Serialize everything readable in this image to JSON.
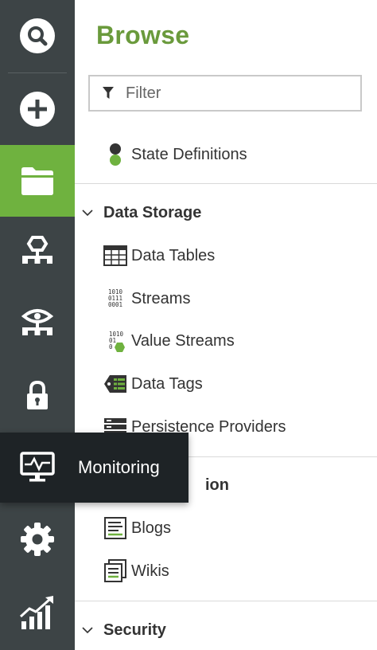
{
  "sidebar": {
    "items": [
      {
        "name": "search"
      },
      {
        "name": "new"
      },
      {
        "name": "browse",
        "active": true
      },
      {
        "name": "modeling"
      },
      {
        "name": "visibility"
      },
      {
        "name": "security"
      },
      {
        "name": "monitoring"
      },
      {
        "name": "settings"
      },
      {
        "name": "analytics"
      }
    ],
    "active_color": "#6fb23f",
    "background_color": "#3d4446"
  },
  "browse": {
    "title": "Browse",
    "title_color": "#6a9a3c",
    "filter_placeholder": "Filter",
    "state_definitions": "State Definitions",
    "data_storage": {
      "label": "Data Storage",
      "items": [
        "Data Tables",
        "Streams",
        "Value Streams",
        "Data Tags",
        "Persistence Providers"
      ]
    },
    "collaboration": {
      "label_visible": "ion",
      "items": [
        "Blogs",
        "Wikis"
      ]
    },
    "security": {
      "label": "Security"
    }
  },
  "tooltip": {
    "label": "Monitoring"
  },
  "icons": {
    "binary_a": [
      "1010",
      "0111",
      "0001"
    ],
    "binary_b": [
      "1010",
      "01",
      "0"
    ]
  }
}
